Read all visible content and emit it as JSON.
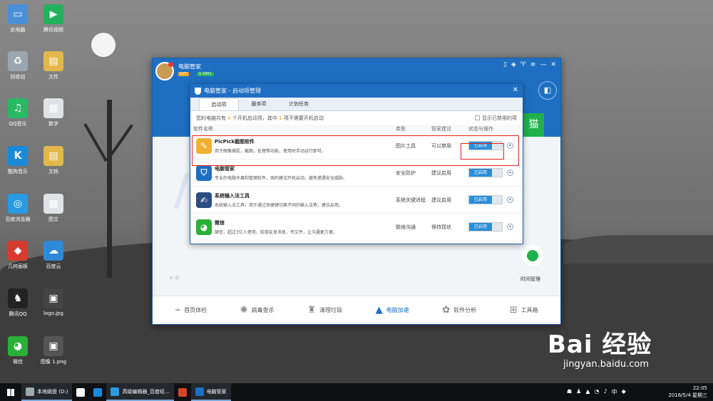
{
  "desktop": {
    "icons": [
      {
        "label": "此电脑",
        "icon": "computer-icon",
        "color": "#4a90d9"
      },
      {
        "label": "腾讯视频",
        "icon": "tencent-video-icon",
        "color": "#21b25b"
      },
      {
        "label": "回收站",
        "icon": "recycle-bin-icon",
        "color": "#9aa6b0"
      },
      {
        "label": "文件",
        "icon": "folder-icon",
        "color": "#e3b84a"
      },
      {
        "label": "QQ音乐",
        "icon": "qq-music-icon",
        "color": "#29b864"
      },
      {
        "label": "数字",
        "icon": "document-icon",
        "color": "#dfe3e7"
      },
      {
        "label": "酷狗音乐",
        "icon": "kugou-icon",
        "color": "#1a8ad8"
      },
      {
        "label": "文档",
        "icon": "folder-icon",
        "color": "#e3b84a"
      },
      {
        "label": "百度浏览器",
        "icon": "baidu-browser-icon",
        "color": "#2a9be0"
      },
      {
        "label": "图文",
        "icon": "document-icon",
        "color": "#dfe3e7"
      },
      {
        "label": "几何画板",
        "icon": "geometry-icon",
        "color": "#d83a2e"
      },
      {
        "label": "百度云",
        "icon": "baidu-cloud-icon",
        "color": "#2d8ad8"
      },
      {
        "label": "腾讯QQ",
        "icon": "qq-icon",
        "color": "#222"
      },
      {
        "label": "logo.jpg",
        "icon": "image-icon",
        "color": "#444"
      },
      {
        "label": "微信",
        "icon": "wechat-icon",
        "color": "#2ab03a"
      },
      {
        "label": "图像 1.png",
        "icon": "image-icon",
        "color": "#555"
      }
    ],
    "watermark": {
      "logo": "Bai 经验",
      "url": "jingyan.baidu.com"
    }
  },
  "app": {
    "title": "电脑管家",
    "level": "LV7",
    "points": "$ 2001",
    "accent": "#1e6fc2",
    "green_btn": "猫",
    "left_hint": "小",
    "right_hint": "时间管理",
    "toolbar": [
      {
        "label": "首页体检",
        "icon": "chart-icon",
        "active": false
      },
      {
        "label": "病毒查杀",
        "icon": "virus-scan-icon",
        "active": false
      },
      {
        "label": "清理垃圾",
        "icon": "broom-icon",
        "active": false
      },
      {
        "label": "电脑加速",
        "icon": "rocket-icon",
        "active": true
      },
      {
        "label": "软件分析",
        "icon": "software-icon",
        "active": false
      },
      {
        "label": "工具箱",
        "icon": "toolbox-icon",
        "active": false
      }
    ]
  },
  "dialog": {
    "title": "电脑管家 - 启动项管理",
    "tabs": [
      "启动项",
      "服务项",
      "计划任务"
    ],
    "active_tab": 0,
    "summary": {
      "pre": "您的电脑共有",
      "count": "4",
      "mid": "个开机启动项，其中",
      "count2": "1",
      "post": "项不需要开机启动"
    },
    "show_disabled": "显示已禁用的项",
    "columns": [
      "软件名称",
      "类型",
      "管家建议",
      "状态与操作"
    ],
    "rows": [
      {
        "name": "PicPick截图软件",
        "desc": "用于图像捕捉，截图，处理等功能，使用时手动运行即可。",
        "type": "图片工具",
        "advice": "可以禁用",
        "status": "已启用",
        "icon": "picpick-icon",
        "color": "#f0b032"
      },
      {
        "name": "电脑管家",
        "desc": "专业的电脑杀毒和管理软件。强烈建议开机启动，避免遭遇安全威胁。",
        "type": "安全防护",
        "advice": "建议启用",
        "status": "已启用",
        "icon": "shield-icon",
        "color": "#1e6fc2"
      },
      {
        "name": "系统输入法工具",
        "desc": "系统输入法工具，用于通过快捷键切换不同的输入法等，建议启用。",
        "type": "系统关键进程",
        "advice": "建议启用",
        "status": "已启用",
        "icon": "input-method-icon",
        "color": "#2c4d84"
      },
      {
        "name": "微信",
        "desc": "微信，超过3亿人使用，给朋友发消息，传文件，让沟通更方便。",
        "type": "联络沟通",
        "advice": "保持现状",
        "status": "已启用",
        "icon": "wechat-icon",
        "color": "#2ab03a"
      }
    ]
  },
  "taskbar": {
    "items": [
      {
        "label": "本地磁盘 (D:)",
        "icon": "drive-icon",
        "color": "#9aa"
      },
      {
        "label": "",
        "icon": "store-icon",
        "color": "#fff"
      },
      {
        "label": "",
        "icon": "kugou-icon",
        "color": "#1a8ad8"
      },
      {
        "label": "高级编辑器_百度经...",
        "icon": "browser-icon",
        "color": "#2a9be0"
      },
      {
        "label": "",
        "icon": "powerpoint-icon",
        "color": "#d24726"
      },
      {
        "label": "电脑管家",
        "icon": "shield-icon",
        "color": "#1e6fc2"
      }
    ],
    "time": "22:05",
    "date": "2016/5/4 星期三"
  }
}
